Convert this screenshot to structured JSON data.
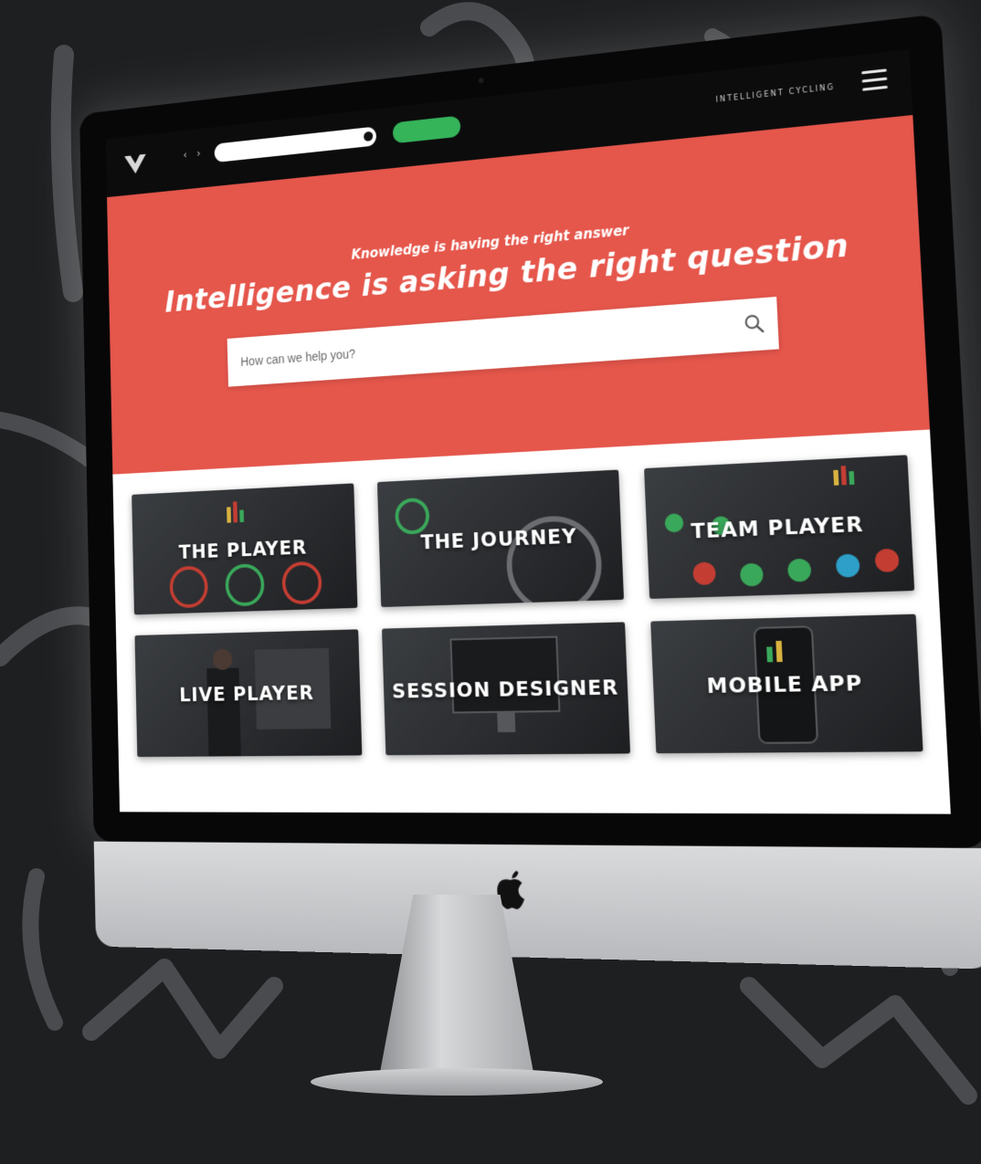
{
  "browser": {
    "url_value": "",
    "go_button_label": "",
    "nav_arrows": "‹ ›"
  },
  "header": {
    "tagline": "INTELLIGENT CYCLING",
    "logo_icon": "v-logo-icon",
    "menu_icon": "hamburger-icon"
  },
  "hero": {
    "subtitle": "Knowledge is having the right answer",
    "title": "Intelligence is asking the right question",
    "search_placeholder": "How can we help you?",
    "search_icon": "search-icon"
  },
  "tiles": [
    {
      "label": "THE PLAYER"
    },
    {
      "label": "THE JOURNEY"
    },
    {
      "label": "TEAM PLAYER"
    },
    {
      "label": "LIVE PLAYER"
    },
    {
      "label": "SESSION DESIGNER"
    },
    {
      "label": "MOBILE APP"
    }
  ],
  "colors": {
    "hero_red": "#e5564b",
    "accent_green": "#35b45a",
    "tile_dark": "#2a2c2f",
    "page_background": "#1e1f21"
  },
  "device": {
    "logo_icon": "apple-icon"
  }
}
